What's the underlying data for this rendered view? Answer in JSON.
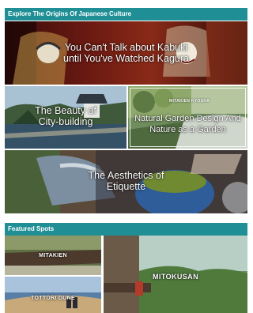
{
  "explore": {
    "header": "Explore The Origins Of Japanese Culture",
    "tiles": [
      {
        "line1": "You Can't Talk about Kabuki",
        "line2": "until You've Watched Kagura"
      },
      {
        "line1": "The Beauty of",
        "line2": "City-building"
      },
      {
        "line1": "Natural Garden Design And",
        "line2": "Nature as a Garden",
        "tag_left": "MITAKIEN",
        "tag_right": "KYOSHA"
      },
      {
        "line1": "The Aesthetics of",
        "line2": "Etiquette"
      }
    ]
  },
  "featured": {
    "header": "Featured Spots",
    "spots": [
      {
        "label": "MITAKIEN"
      },
      {
        "label": "TOTTORI DUNE"
      },
      {
        "label": "MITOKUSAN"
      }
    ]
  }
}
